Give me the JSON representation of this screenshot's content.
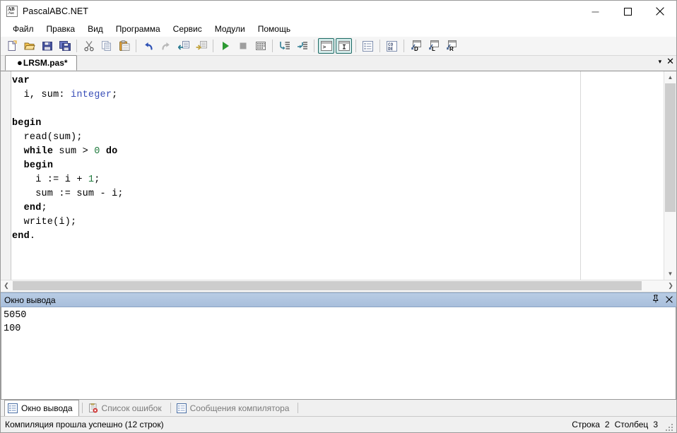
{
  "window": {
    "title": "PascalABC.NET",
    "icon_name": "pascalabc-logo-icon",
    "icon_top_text": "AB",
    "icon_bottom_text": ".Net",
    "minimize_label": "minimize-icon",
    "maximize_label": "maximize-icon",
    "close_label": "close-icon"
  },
  "menu": {
    "items": [
      {
        "label": "Файл"
      },
      {
        "label": "Правка"
      },
      {
        "label": "Вид"
      },
      {
        "label": "Программа"
      },
      {
        "label": "Сервис"
      },
      {
        "label": "Модули"
      },
      {
        "label": "Помощь"
      }
    ]
  },
  "toolbar": {
    "groups": [
      {
        "buttons": [
          {
            "name": "new-file-button",
            "icon": "new-file-icon",
            "toggled": false
          },
          {
            "name": "open-file-button",
            "icon": "open-folder-icon",
            "toggled": false
          },
          {
            "name": "save-file-button",
            "icon": "save-diskette-icon",
            "toggled": false
          },
          {
            "name": "save-all-button",
            "icon": "save-all-icon",
            "toggled": false
          }
        ]
      },
      {
        "buttons": [
          {
            "name": "cut-button",
            "icon": "scissors-icon",
            "toggled": false
          },
          {
            "name": "copy-button",
            "icon": "copy-icon",
            "toggled": false
          },
          {
            "name": "paste-button",
            "icon": "clipboard-paste-icon",
            "toggled": false
          }
        ]
      },
      {
        "buttons": [
          {
            "name": "undo-button",
            "icon": "undo-arrow-icon",
            "toggled": false
          },
          {
            "name": "redo-button",
            "icon": "redo-arrow-icon",
            "toggled": false
          },
          {
            "name": "unindent-button",
            "icon": "outdent-icon",
            "toggled": false
          },
          {
            "name": "indent-button",
            "icon": "indent-icon",
            "toggled": false
          }
        ]
      },
      {
        "buttons": [
          {
            "name": "run-button",
            "icon": "run-play-icon",
            "toggled": false
          },
          {
            "name": "stop-button",
            "icon": "stop-square-icon",
            "toggled": false
          },
          {
            "name": "build-button",
            "icon": "build-bricks-icon",
            "toggled": false
          }
        ]
      },
      {
        "buttons": [
          {
            "name": "step-into-button",
            "icon": "step-into-icon",
            "toggled": false
          },
          {
            "name": "step-over-button",
            "icon": "step-over-icon",
            "toggled": false
          }
        ]
      },
      {
        "buttons": [
          {
            "name": "console-window-button",
            "icon": "console-window-icon",
            "toggled": true
          },
          {
            "name": "input-window-button",
            "icon": "text-cursor-window-icon",
            "toggled": true
          }
        ]
      },
      {
        "buttons": [
          {
            "name": "output-window-button",
            "icon": "output-list-icon",
            "toggled": false
          }
        ]
      },
      {
        "buttons": [
          {
            "name": "code-view-button",
            "icon": "code-icon",
            "toggled": false
          }
        ]
      },
      {
        "buttons": [
          {
            "name": "template-d-button",
            "icon": "template-d-icon",
            "label": "D",
            "toggled": false
          },
          {
            "name": "template-l-button",
            "icon": "template-l-icon",
            "label": "L",
            "toggled": false
          },
          {
            "name": "template-r-button",
            "icon": "template-r-icon",
            "label": "R",
            "toggled": false
          }
        ]
      }
    ]
  },
  "editor": {
    "tab": {
      "modified_marker": "●",
      "filename": "LRSM.pas*"
    },
    "tab_actions": {
      "dropdown_icon": "▾",
      "close_icon": "✕"
    },
    "code_lines": [
      [
        {
          "t": "var",
          "c": "kw"
        }
      ],
      [
        {
          "t": "  i, sum: ",
          "c": ""
        },
        {
          "t": "integer",
          "c": "type"
        },
        {
          "t": ";",
          "c": ""
        }
      ],
      [
        {
          "t": "",
          "c": ""
        }
      ],
      [
        {
          "t": "begin",
          "c": "kw"
        }
      ],
      [
        {
          "t": "  read(sum);",
          "c": ""
        }
      ],
      [
        {
          "t": "  ",
          "c": ""
        },
        {
          "t": "while",
          "c": "kw"
        },
        {
          "t": " sum > ",
          "c": ""
        },
        {
          "t": "0",
          "c": "num"
        },
        {
          "t": " ",
          "c": ""
        },
        {
          "t": "do",
          "c": "kw"
        }
      ],
      [
        {
          "t": "  ",
          "c": ""
        },
        {
          "t": "begin",
          "c": "kw"
        }
      ],
      [
        {
          "t": "    i := i + ",
          "c": ""
        },
        {
          "t": "1",
          "c": "num"
        },
        {
          "t": ";",
          "c": ""
        }
      ],
      [
        {
          "t": "    sum := sum - i;",
          "c": ""
        }
      ],
      [
        {
          "t": "  ",
          "c": ""
        },
        {
          "t": "end",
          "c": "kw"
        },
        {
          "t": ";",
          "c": ""
        }
      ],
      [
        {
          "t": "  write(i);",
          "c": ""
        }
      ],
      [
        {
          "t": "end",
          "c": "kw"
        },
        {
          "t": ".",
          "c": ""
        }
      ]
    ]
  },
  "output": {
    "title": "Окно вывода",
    "pin_icon": "⚲",
    "close_icon": "✕",
    "text": "5050\n100"
  },
  "bottom_tabs": [
    {
      "label": "Окно вывода",
      "icon": "output-window-icon",
      "active": true
    },
    {
      "label": "Список ошибок",
      "icon": "error-list-icon",
      "active": false
    },
    {
      "label": "Сообщения компилятора",
      "icon": "compiler-messages-icon",
      "active": false
    }
  ],
  "status": {
    "message": "Компиляция прошла успешно (12 строк)",
    "line_label": "Строка",
    "line_value": "2",
    "column_label": "Столбец",
    "column_value": "3"
  },
  "colors": {
    "keyword": "#000000",
    "type": "#3a4fb8",
    "number": "#1f7a3d",
    "panel_header": "#b8cce4",
    "toggle_border": "#1c6a64"
  }
}
